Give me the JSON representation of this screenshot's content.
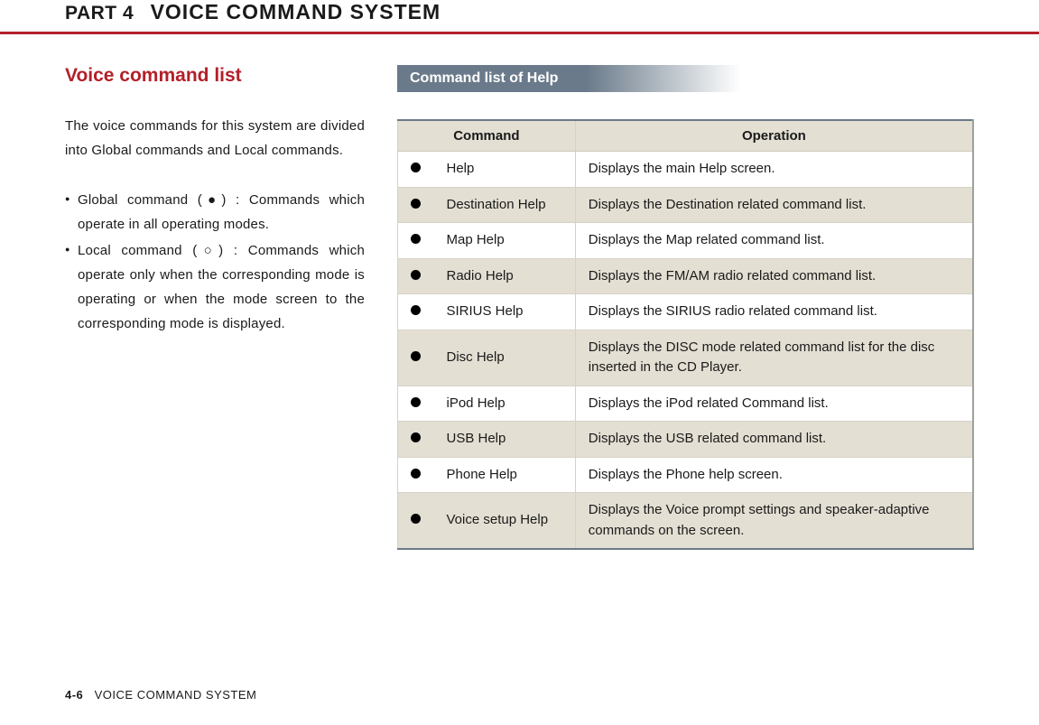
{
  "header": {
    "part": "PART 4",
    "title": "VOICE COMMAND SYSTEM"
  },
  "left": {
    "heading": "Voice command list",
    "intro": "The voice commands for this system are divided into Global commands and Local commands.",
    "bullets": [
      "Global command (●) : Commands which operate in all operating modes.",
      "Local command (○) : Commands which operate only when the corresponding mode is operating or when the mode screen to the corresponding mode is displayed."
    ]
  },
  "right": {
    "subheading": "Command list of Help",
    "columns": {
      "cmd": "Command",
      "op": "Operation"
    },
    "rows": [
      {
        "cmd": "Help",
        "op": "Displays the main Help screen."
      },
      {
        "cmd": "Destination Help",
        "op": "Displays the Destination related command list."
      },
      {
        "cmd": "Map Help",
        "op": "Displays the Map related command list."
      },
      {
        "cmd": "Radio Help",
        "op": "Displays the FM/AM radio related command list."
      },
      {
        "cmd": "SIRIUS Help",
        "op": "Displays the SIRIUS radio related command list."
      },
      {
        "cmd": "Disc Help",
        "op": "Displays the DISC mode related command list for the disc inserted in the CD Player."
      },
      {
        "cmd": "iPod Help",
        "op": "Displays the iPod related Command list."
      },
      {
        "cmd": "USB Help",
        "op": "Displays the USB related command list."
      },
      {
        "cmd": "Phone Help",
        "op": "Displays the Phone help screen."
      },
      {
        "cmd": "Voice setup Help",
        "op": "Displays the Voice prompt settings and speaker-adaptive commands on the screen."
      }
    ]
  },
  "footer": {
    "page": "4-6",
    "label": "VOICE COMMAND SYSTEM"
  }
}
